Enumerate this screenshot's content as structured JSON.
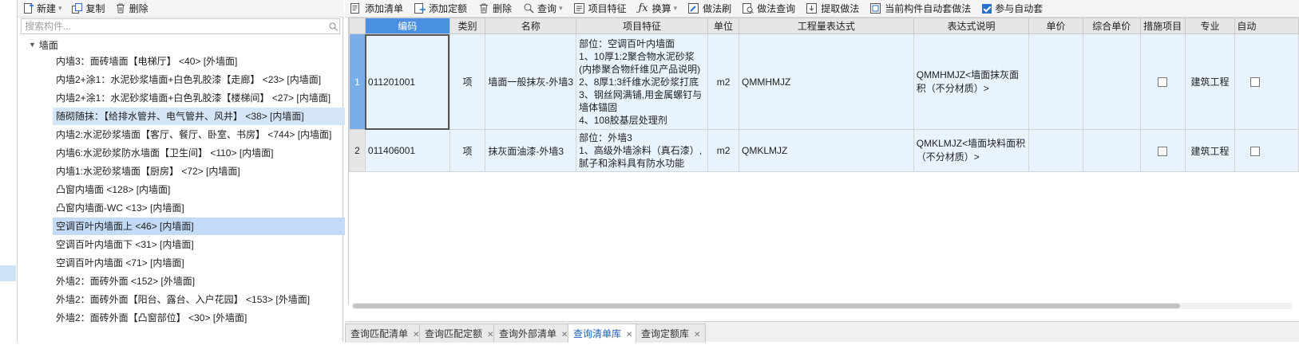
{
  "left_toolbar": {
    "new_label": "新建",
    "copy_label": "复制",
    "delete_label": "删除"
  },
  "search": {
    "placeholder": "搜索构件..."
  },
  "tree": {
    "root_label": "墙面",
    "items": [
      "内墙3：面砖墙面【电梯厅】 <40> [外墙面]",
      "内墙2+涂1：水泥砂浆墙面+白色乳胶漆【走廊】 <23> [内墙面]",
      "内墙2+涂1：水泥砂浆墙面+白色乳胶漆【楼梯间】 <27> [内墙面]",
      "随砌随抹：【给排水管井、电气管井、风井】 <38> [内墙面]",
      "内墙2:水泥砂浆墙面【客厅、餐厅、卧室、书房】 <744> [内墙面]",
      "内墙6:水泥砂浆防水墙面【卫生间】 <110> [内墙面]",
      "内墙1:水泥砂浆墙面【厨房】 <72> [内墙面]",
      "凸窗内墙面 <128> [内墙面]",
      "凸窗内墙面-WC <13> [内墙面]",
      "空调百叶内墙面上 <46> [内墙面]",
      "空调百叶内墙面下 <31> [内墙面]",
      "空调百叶内墙面 <71> [内墙面]",
      "外墙2：面砖外面 <152> [外墙面]",
      "外墙2：面砖外面【阳台、露台、入户花园】 <153> [外墙面]",
      "外墙2：面砖外面【凸窗部位】 <30> [外墙面]"
    ]
  },
  "right_toolbar": {
    "add_list": "添加清单",
    "add_quota": "添加定额",
    "delete": "删除",
    "query": "查询",
    "item_feature": "项目特征",
    "convert": "换算",
    "method_brush": "做法刷",
    "method_query": "做法查询",
    "extract_method": "提取做法",
    "auto_apply": "当前构件自动套做法",
    "participate_auto": "参与自动套"
  },
  "grid": {
    "headers": [
      "编码",
      "类别",
      "名称",
      "项目特征",
      "单位",
      "工程量表达式",
      "表达式说明",
      "单价",
      "综合单价",
      "措施项目",
      "专业",
      "自动"
    ],
    "rows": [
      {
        "num": "1",
        "code": "011201001",
        "type": "项",
        "name": "墙面一般抹灰-外墙3",
        "feature": "部位：空调百叶内墙面\n1、10厚1:2聚合物水泥砂浆(内掺聚合物纤维见产品说明)\n2、8厚1:3纤维水泥砂浆打底\n3、钢丝网满铺,用金属螺钉与墙体锚固\n4、108胶基层处理剂",
        "unit": "m2",
        "expr": "QMMHMJZ",
        "expr_desc": "QMMHMJZ<墙面抹灰面积（不分材质）>",
        "price": "",
        "comp_price": "",
        "specialty": "建筑工程"
      },
      {
        "num": "2",
        "code": "011406001",
        "type": "项",
        "name": "抹灰面油漆-外墙3",
        "feature": "部位：外墙3\n1、高级外墙涂料（真石漆）,腻子和涂料具有防水功能",
        "unit": "m2",
        "expr": "QMKLMJZ",
        "expr_desc": "QMKLMJZ<墙面块料面积（不分材质）>",
        "price": "",
        "comp_price": "",
        "specialty": "建筑工程"
      }
    ]
  },
  "bottom_tabs": [
    "查询匹配清单",
    "查询匹配定额",
    "查询外部清单",
    "查询清单库",
    "查询定额库"
  ],
  "colors": {
    "accent": "#4a90e2",
    "selection": "#c3dbf7",
    "row_bg": "#e9f3fd"
  }
}
